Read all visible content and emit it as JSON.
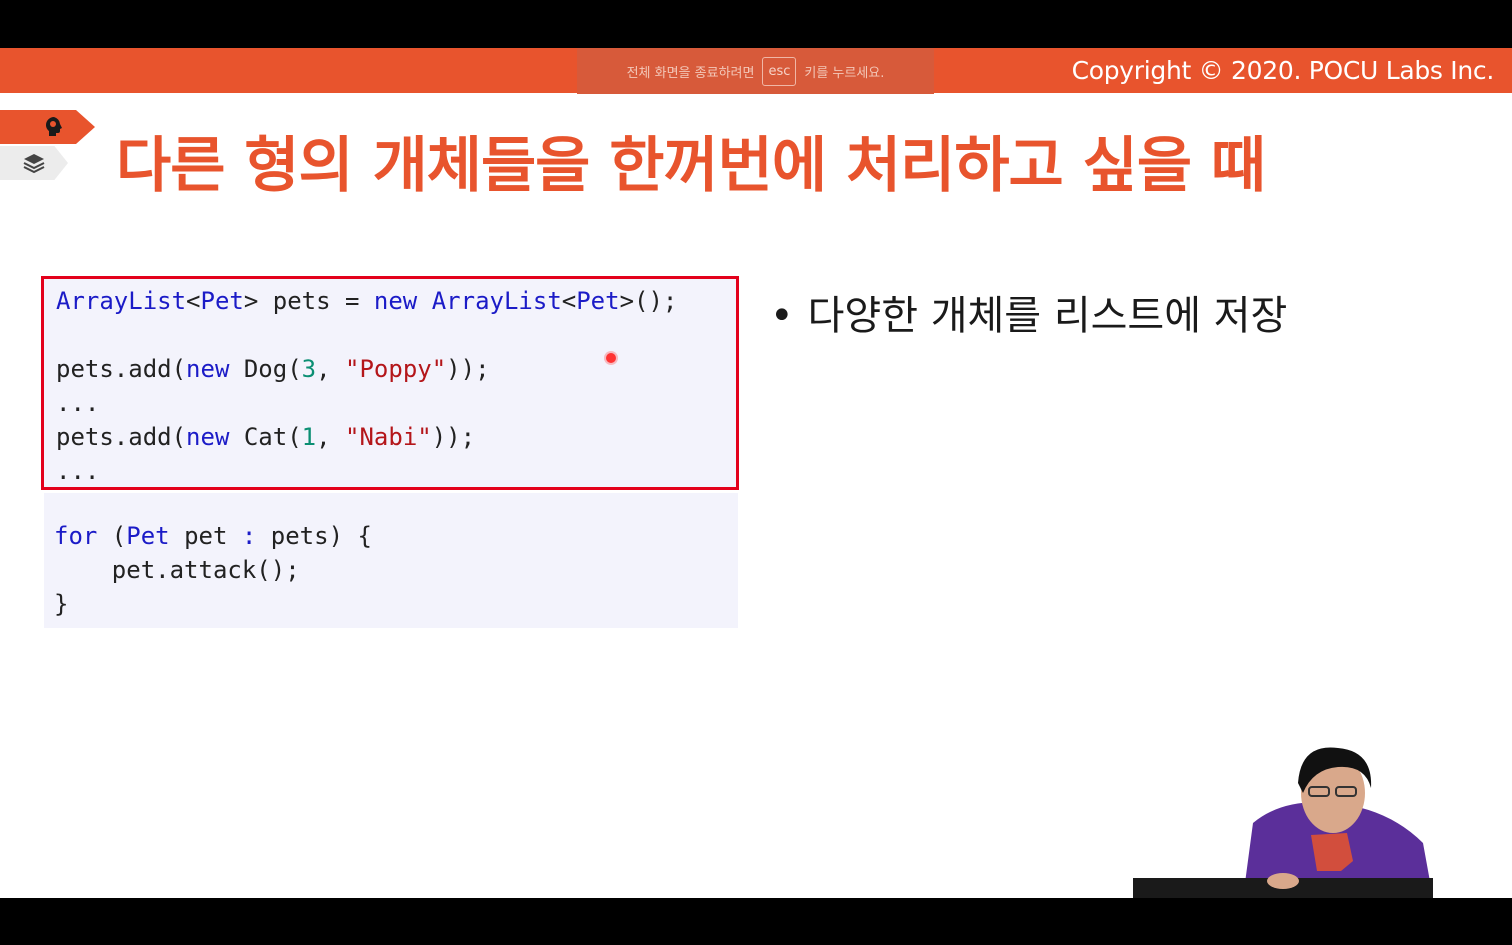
{
  "header": {
    "copyright": "Copyright © 2020. POCU Labs Inc."
  },
  "fullscreen_toast": {
    "before": "전체 화면을 종료하려면",
    "key": "esc",
    "after": "키를 누르세요."
  },
  "slide": {
    "title": "다른 형의 개체들을 한꺼번에 처리하고 싶을 때",
    "bullets": [
      "다양한 개체를 리스트에 저장"
    ]
  },
  "code_top": {
    "line1": {
      "t1": "ArrayList",
      "t2": "<",
      "t3": "Pet",
      "t4": "> pets = ",
      "t5": "new",
      "t6": " ",
      "t7": "ArrayList",
      "t8": "<",
      "t9": "Pet",
      "t10": ">();"
    },
    "line3": {
      "a": "pets.add(",
      "b": "new",
      "c": " Dog(",
      "d": "3",
      "e": ", ",
      "f": "\"Poppy\"",
      "g": "));"
    },
    "line4": "...",
    "line5": {
      "a": "pets.add(",
      "b": "new",
      "c": " Cat(",
      "d": "1",
      "e": ", ",
      "f": "\"Nabi\"",
      "g": "));"
    },
    "line6": "..."
  },
  "code_bottom": {
    "line1": {
      "a": "for",
      "b": " (",
      "c": "Pet",
      "d": " pet ",
      "e": ":",
      "f": " pets) {"
    },
    "line2": "    pet.attack();",
    "line3": "}"
  },
  "colors": {
    "accent": "#E8542D",
    "code_keyword": "#1b1bc7",
    "code_number": "#0b8f73",
    "code_string": "#b4161a",
    "highlight_border": "#E3001B"
  }
}
